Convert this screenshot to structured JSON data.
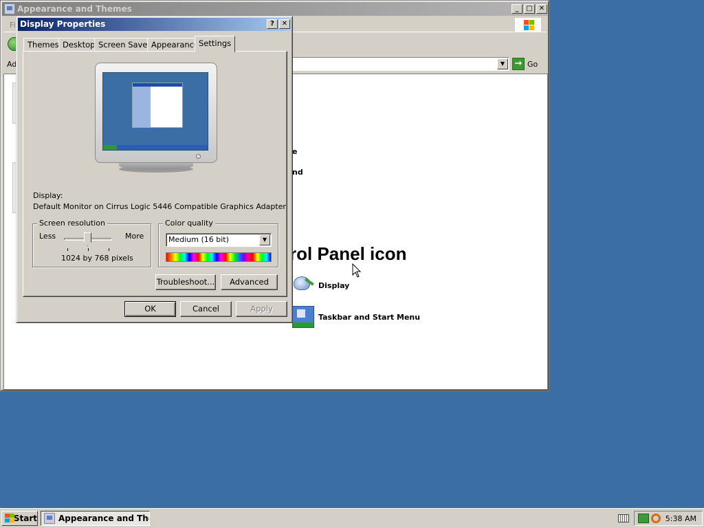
{
  "explorer": {
    "title": "Appearance and Themes",
    "menu_fragment": "Fil",
    "address_label": "Ad",
    "go_label": "Go",
    "heading_fragment": "rol Panel icon",
    "fragments": [
      "e",
      "nd"
    ],
    "cp_items": [
      {
        "label": "Display",
        "icon": "display-icon"
      },
      {
        "label": "Taskbar and Start Menu",
        "icon": "taskbar-icon"
      }
    ]
  },
  "dialog": {
    "title": "Display Properties",
    "help_glyph": "?",
    "close_glyph": "✕",
    "tabs": [
      "Themes",
      "Desktop",
      "Screen Saver",
      "Appearance",
      "Settings"
    ],
    "active_tab": "Settings",
    "display_label": "Display:",
    "display_value": "Default Monitor on Cirrus Logic 5446 Compatible Graphics Adapter",
    "resolution": {
      "title": "Screen resolution",
      "less": "Less",
      "more": "More",
      "value_text": "1024 by 768 pixels",
      "slider_level": 0.5
    },
    "color_quality": {
      "title": "Color quality",
      "selected": "Medium (16 bit)"
    },
    "buttons": {
      "troubleshoot": "Troubleshoot...",
      "advanced": "Advanced",
      "ok": "OK",
      "cancel": "Cancel",
      "apply": "Apply"
    }
  },
  "taskbar": {
    "start_label": "Start",
    "task_label": "Appearance and The...",
    "clock": "5:38 AM"
  },
  "colors": {
    "desktop": "#3a6ea5",
    "active_title": "#0a246a",
    "inactive_title": "#808080",
    "face": "#d4d0c8"
  }
}
